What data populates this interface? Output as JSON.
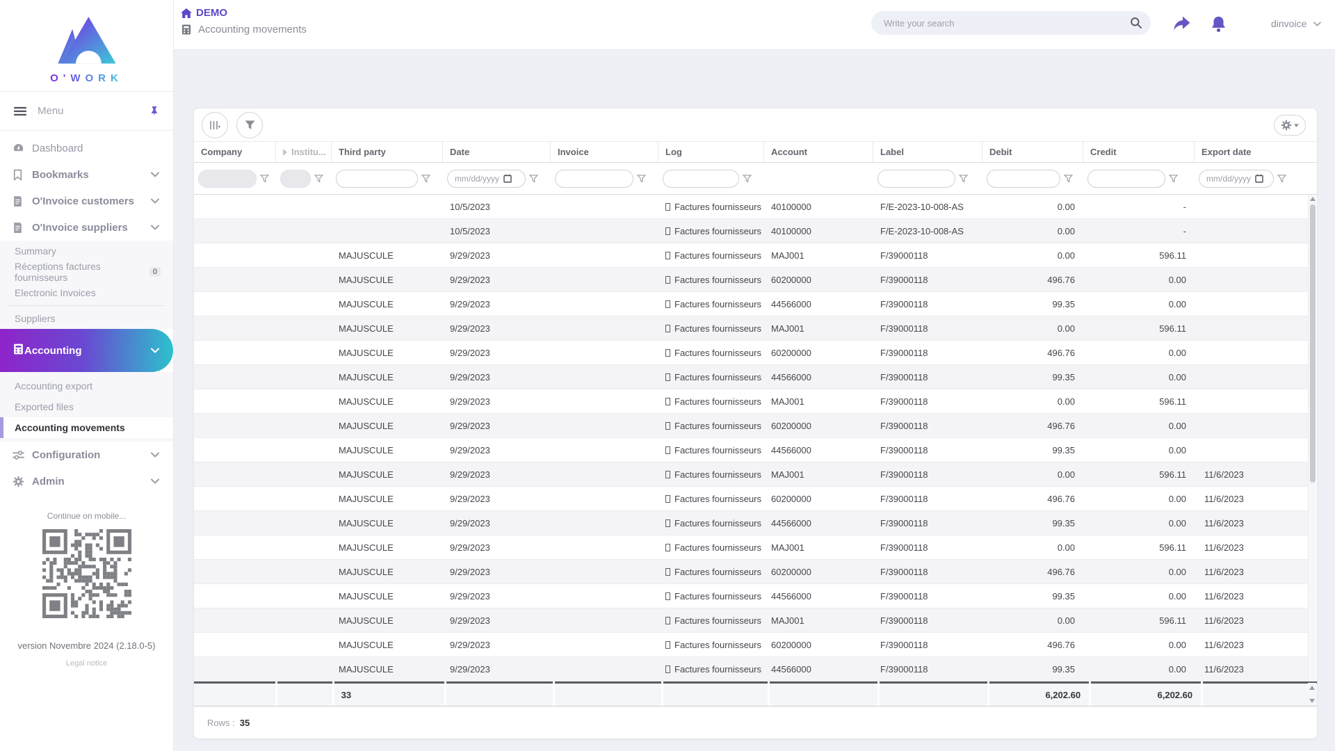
{
  "brand": {
    "name": "O'WORK"
  },
  "colors": {
    "accent": "#6554c0",
    "gradient_from": "#8e24c9",
    "gradient_to": "#2cc2cc"
  },
  "topbar": {
    "breadcrumb_root": "DEMO",
    "breadcrumb_page": "Accounting movements",
    "search_placeholder": "Write your search",
    "user": "dinvoice"
  },
  "sidebar": {
    "menu_label": "Menu",
    "dashboard": "Dashboard",
    "bookmarks": "Bookmarks",
    "oinvoice_customers": "O'Invoice customers",
    "oinvoice_suppliers": "O'Invoice suppliers",
    "suppliers_submenu": {
      "summary": "Summary",
      "receptions": "Réceptions factures fournisseurs",
      "receptions_badge": "0",
      "electronic": "Electronic Invoices",
      "suppliers": "Suppliers"
    },
    "accounting": "Accounting",
    "accounting_submenu": {
      "export": "Accounting export",
      "exported": "Exported files",
      "movements": "Accounting movements"
    },
    "configuration": "Configuration",
    "admin": "Admin",
    "mobile_hint": "Continue on mobile...",
    "version": "version Novembre 2024 (2.18.0-5)",
    "legal": "Legal notice"
  },
  "table": {
    "headers": {
      "company": "Company",
      "institution": "Institu...",
      "third_party": "Third party",
      "date": "Date",
      "invoice": "Invoice",
      "log": "Log",
      "account": "Account",
      "label": "Label",
      "debit": "Debit",
      "credit": "Credit",
      "export_date": "Export date"
    },
    "date_placeholder": "mm/dd/yyyy",
    "rows": [
      {
        "company": "",
        "institution": "",
        "third_party": "",
        "date": "10/5/2023",
        "invoice": "",
        "log": "Factures fournisseurs",
        "account": "40100000",
        "label": "F/E-2023-10-008-AS",
        "debit": "0.00",
        "credit": "-",
        "export_date": ""
      },
      {
        "company": "",
        "institution": "",
        "third_party": "",
        "date": "10/5/2023",
        "invoice": "",
        "log": "Factures fournisseurs",
        "account": "40100000",
        "label": "F/E-2023-10-008-AS",
        "debit": "0.00",
        "credit": "-",
        "export_date": ""
      },
      {
        "company": "",
        "institution": "",
        "third_party": "MAJUSCULE",
        "date": "9/29/2023",
        "invoice": "",
        "log": "Factures fournisseurs",
        "account": "MAJ001",
        "label": "F/39000118",
        "debit": "0.00",
        "credit": "596.11",
        "export_date": ""
      },
      {
        "company": "",
        "institution": "",
        "third_party": "MAJUSCULE",
        "date": "9/29/2023",
        "invoice": "",
        "log": "Factures fournisseurs",
        "account": "60200000",
        "label": "F/39000118",
        "debit": "496.76",
        "credit": "0.00",
        "export_date": ""
      },
      {
        "company": "",
        "institution": "",
        "third_party": "MAJUSCULE",
        "date": "9/29/2023",
        "invoice": "",
        "log": "Factures fournisseurs",
        "account": "44566000",
        "label": "F/39000118",
        "debit": "99.35",
        "credit": "0.00",
        "export_date": ""
      },
      {
        "company": "",
        "institution": "",
        "third_party": "MAJUSCULE",
        "date": "9/29/2023",
        "invoice": "",
        "log": "Factures fournisseurs",
        "account": "MAJ001",
        "label": "F/39000118",
        "debit": "0.00",
        "credit": "596.11",
        "export_date": ""
      },
      {
        "company": "",
        "institution": "",
        "third_party": "MAJUSCULE",
        "date": "9/29/2023",
        "invoice": "",
        "log": "Factures fournisseurs",
        "account": "60200000",
        "label": "F/39000118",
        "debit": "496.76",
        "credit": "0.00",
        "export_date": ""
      },
      {
        "company": "",
        "institution": "",
        "third_party": "MAJUSCULE",
        "date": "9/29/2023",
        "invoice": "",
        "log": "Factures fournisseurs",
        "account": "44566000",
        "label": "F/39000118",
        "debit": "99.35",
        "credit": "0.00",
        "export_date": ""
      },
      {
        "company": "",
        "institution": "",
        "third_party": "MAJUSCULE",
        "date": "9/29/2023",
        "invoice": "",
        "log": "Factures fournisseurs",
        "account": "MAJ001",
        "label": "F/39000118",
        "debit": "0.00",
        "credit": "596.11",
        "export_date": ""
      },
      {
        "company": "",
        "institution": "",
        "third_party": "MAJUSCULE",
        "date": "9/29/2023",
        "invoice": "",
        "log": "Factures fournisseurs",
        "account": "60200000",
        "label": "F/39000118",
        "debit": "496.76",
        "credit": "0.00",
        "export_date": ""
      },
      {
        "company": "",
        "institution": "",
        "third_party": "MAJUSCULE",
        "date": "9/29/2023",
        "invoice": "",
        "log": "Factures fournisseurs",
        "account": "44566000",
        "label": "F/39000118",
        "debit": "99.35",
        "credit": "0.00",
        "export_date": ""
      },
      {
        "company": "",
        "institution": "",
        "third_party": "MAJUSCULE",
        "date": "9/29/2023",
        "invoice": "",
        "log": "Factures fournisseurs",
        "account": "MAJ001",
        "label": "F/39000118",
        "debit": "0.00",
        "credit": "596.11",
        "export_date": "11/6/2023"
      },
      {
        "company": "",
        "institution": "",
        "third_party": "MAJUSCULE",
        "date": "9/29/2023",
        "invoice": "",
        "log": "Factures fournisseurs",
        "account": "60200000",
        "label": "F/39000118",
        "debit": "496.76",
        "credit": "0.00",
        "export_date": "11/6/2023"
      },
      {
        "company": "",
        "institution": "",
        "third_party": "MAJUSCULE",
        "date": "9/29/2023",
        "invoice": "",
        "log": "Factures fournisseurs",
        "account": "44566000",
        "label": "F/39000118",
        "debit": "99.35",
        "credit": "0.00",
        "export_date": "11/6/2023"
      },
      {
        "company": "",
        "institution": "",
        "third_party": "MAJUSCULE",
        "date": "9/29/2023",
        "invoice": "",
        "log": "Factures fournisseurs",
        "account": "MAJ001",
        "label": "F/39000118",
        "debit": "0.00",
        "credit": "596.11",
        "export_date": "11/6/2023"
      },
      {
        "company": "",
        "institution": "",
        "third_party": "MAJUSCULE",
        "date": "9/29/2023",
        "invoice": "",
        "log": "Factures fournisseurs",
        "account": "60200000",
        "label": "F/39000118",
        "debit": "496.76",
        "credit": "0.00",
        "export_date": "11/6/2023"
      },
      {
        "company": "",
        "institution": "",
        "third_party": "MAJUSCULE",
        "date": "9/29/2023",
        "invoice": "",
        "log": "Factures fournisseurs",
        "account": "44566000",
        "label": "F/39000118",
        "debit": "99.35",
        "credit": "0.00",
        "export_date": "11/6/2023"
      },
      {
        "company": "",
        "institution": "",
        "third_party": "MAJUSCULE",
        "date": "9/29/2023",
        "invoice": "",
        "log": "Factures fournisseurs",
        "account": "MAJ001",
        "label": "F/39000118",
        "debit": "0.00",
        "credit": "596.11",
        "export_date": "11/6/2023"
      },
      {
        "company": "",
        "institution": "",
        "third_party": "MAJUSCULE",
        "date": "9/29/2023",
        "invoice": "",
        "log": "Factures fournisseurs",
        "account": "60200000",
        "label": "F/39000118",
        "debit": "496.76",
        "credit": "0.00",
        "export_date": "11/6/2023"
      },
      {
        "company": "",
        "institution": "",
        "third_party": "MAJUSCULE",
        "date": "9/29/2023",
        "invoice": "",
        "log": "Factures fournisseurs",
        "account": "44566000",
        "label": "F/39000118",
        "debit": "99.35",
        "credit": "0.00",
        "export_date": "11/6/2023"
      }
    ],
    "totals": {
      "third_party": "33",
      "debit": "6,202.60",
      "credit": "6,202.60"
    },
    "footer": {
      "rows_label": "Rows :",
      "rows_value": "35"
    }
  }
}
